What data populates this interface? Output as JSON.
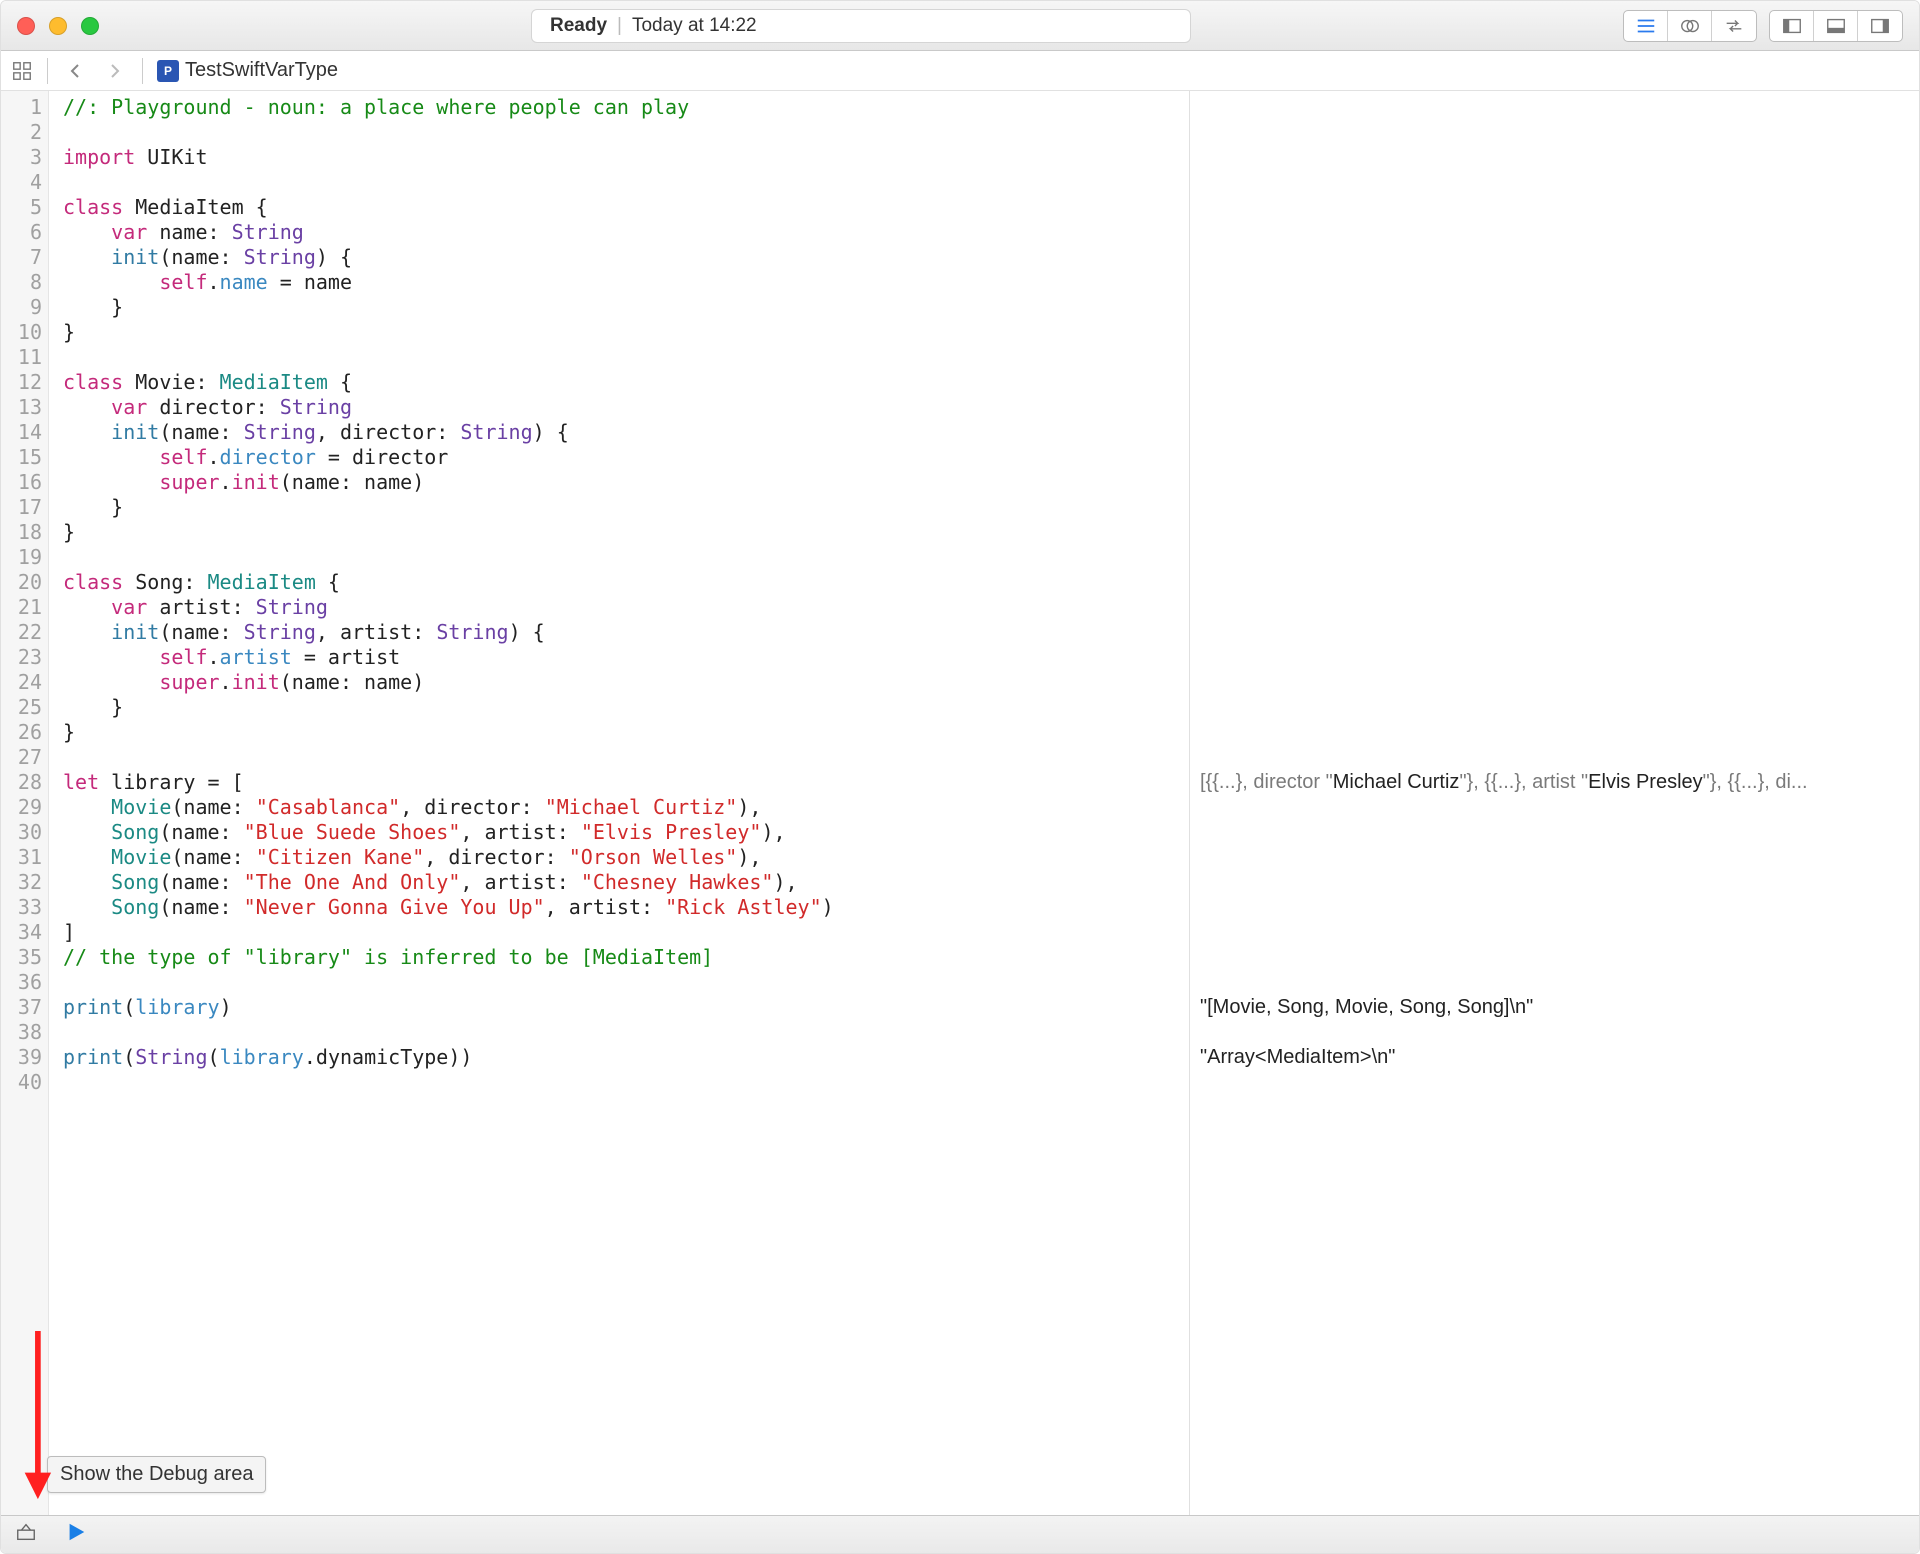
{
  "titlebar": {
    "status_label": "Ready",
    "status_time": "Today at 14:22"
  },
  "jumpbar": {
    "file_name": "TestSwiftVarType"
  },
  "tooltip": {
    "text": "Show the Debug area"
  },
  "code": {
    "lines": [
      [
        {
          "t": "//: Playground - noun: a place where people can play",
          "c": "c-comment"
        }
      ],
      [],
      [
        {
          "t": "import",
          "c": "c-key"
        },
        {
          "t": " UIKit"
        }
      ],
      [],
      [
        {
          "t": "class",
          "c": "c-key"
        },
        {
          "t": " MediaItem {"
        }
      ],
      [
        {
          "t": "    "
        },
        {
          "t": "var",
          "c": "c-key"
        },
        {
          "t": " name: "
        },
        {
          "t": "String",
          "c": "c-type"
        }
      ],
      [
        {
          "t": "    "
        },
        {
          "t": "init",
          "c": "c-param"
        },
        {
          "t": "(name: "
        },
        {
          "t": "String",
          "c": "c-type"
        },
        {
          "t": ") {"
        }
      ],
      [
        {
          "t": "        "
        },
        {
          "t": "self",
          "c": "c-self"
        },
        {
          "t": "."
        },
        {
          "t": "name",
          "c": "c-prop"
        },
        {
          "t": " = name"
        }
      ],
      [
        {
          "t": "    }"
        }
      ],
      [
        {
          "t": "}"
        }
      ],
      [],
      [
        {
          "t": "class",
          "c": "c-key"
        },
        {
          "t": " Movie: "
        },
        {
          "t": "MediaItem",
          "c": "c-usertype"
        },
        {
          "t": " {"
        }
      ],
      [
        {
          "t": "    "
        },
        {
          "t": "var",
          "c": "c-key"
        },
        {
          "t": " director: "
        },
        {
          "t": "String",
          "c": "c-type"
        }
      ],
      [
        {
          "t": "    "
        },
        {
          "t": "init",
          "c": "c-param"
        },
        {
          "t": "(name: "
        },
        {
          "t": "String",
          "c": "c-type"
        },
        {
          "t": ", director: "
        },
        {
          "t": "String",
          "c": "c-type"
        },
        {
          "t": ") {"
        }
      ],
      [
        {
          "t": "        "
        },
        {
          "t": "self",
          "c": "c-self"
        },
        {
          "t": "."
        },
        {
          "t": "director",
          "c": "c-prop"
        },
        {
          "t": " = director"
        }
      ],
      [
        {
          "t": "        "
        },
        {
          "t": "super",
          "c": "c-self"
        },
        {
          "t": "."
        },
        {
          "t": "init",
          "c": "c-key"
        },
        {
          "t": "(name: name)"
        }
      ],
      [
        {
          "t": "    }"
        }
      ],
      [
        {
          "t": "}"
        }
      ],
      [],
      [
        {
          "t": "class",
          "c": "c-key"
        },
        {
          "t": " Song: "
        },
        {
          "t": "MediaItem",
          "c": "c-usertype"
        },
        {
          "t": " {"
        }
      ],
      [
        {
          "t": "    "
        },
        {
          "t": "var",
          "c": "c-key"
        },
        {
          "t": " artist: "
        },
        {
          "t": "String",
          "c": "c-type"
        }
      ],
      [
        {
          "t": "    "
        },
        {
          "t": "init",
          "c": "c-param"
        },
        {
          "t": "(name: "
        },
        {
          "t": "String",
          "c": "c-type"
        },
        {
          "t": ", artist: "
        },
        {
          "t": "String",
          "c": "c-type"
        },
        {
          "t": ") {"
        }
      ],
      [
        {
          "t": "        "
        },
        {
          "t": "self",
          "c": "c-self"
        },
        {
          "t": "."
        },
        {
          "t": "artist",
          "c": "c-prop"
        },
        {
          "t": " = artist"
        }
      ],
      [
        {
          "t": "        "
        },
        {
          "t": "super",
          "c": "c-self"
        },
        {
          "t": "."
        },
        {
          "t": "init",
          "c": "c-key"
        },
        {
          "t": "(name: name)"
        }
      ],
      [
        {
          "t": "    }"
        }
      ],
      [
        {
          "t": "}"
        }
      ],
      [],
      [
        {
          "t": "let",
          "c": "c-key"
        },
        {
          "t": " library = ["
        }
      ],
      [
        {
          "t": "    "
        },
        {
          "t": "Movie",
          "c": "c-usertype"
        },
        {
          "t": "(name: "
        },
        {
          "t": "\"Casablanca\"",
          "c": "c-string"
        },
        {
          "t": ", director: "
        },
        {
          "t": "\"Michael Curtiz\"",
          "c": "c-string"
        },
        {
          "t": "),"
        }
      ],
      [
        {
          "t": "    "
        },
        {
          "t": "Song",
          "c": "c-usertype"
        },
        {
          "t": "(name: "
        },
        {
          "t": "\"Blue Suede Shoes\"",
          "c": "c-string"
        },
        {
          "t": ", artist: "
        },
        {
          "t": "\"Elvis Presley\"",
          "c": "c-string"
        },
        {
          "t": "),"
        }
      ],
      [
        {
          "t": "    "
        },
        {
          "t": "Movie",
          "c": "c-usertype"
        },
        {
          "t": "(name: "
        },
        {
          "t": "\"Citizen Kane\"",
          "c": "c-string"
        },
        {
          "t": ", director: "
        },
        {
          "t": "\"Orson Welles\"",
          "c": "c-string"
        },
        {
          "t": "),"
        }
      ],
      [
        {
          "t": "    "
        },
        {
          "t": "Song",
          "c": "c-usertype"
        },
        {
          "t": "(name: "
        },
        {
          "t": "\"The One And Only\"",
          "c": "c-string"
        },
        {
          "t": ", artist: "
        },
        {
          "t": "\"Chesney Hawkes\"",
          "c": "c-string"
        },
        {
          "t": "),"
        }
      ],
      [
        {
          "t": "    "
        },
        {
          "t": "Song",
          "c": "c-usertype"
        },
        {
          "t": "(name: "
        },
        {
          "t": "\"Never Gonna Give You Up\"",
          "c": "c-string"
        },
        {
          "t": ", artist: "
        },
        {
          "t": "\"Rick Astley\"",
          "c": "c-string"
        },
        {
          "t": ")"
        }
      ],
      [
        {
          "t": "]"
        }
      ],
      [
        {
          "t": "// the type of \"library\" is inferred to be [MediaItem]",
          "c": "c-comment"
        }
      ],
      [],
      [
        {
          "t": "print",
          "c": "c-param"
        },
        {
          "t": "("
        },
        {
          "t": "library",
          "c": "c-prop"
        },
        {
          "t": ")"
        }
      ],
      [],
      [
        {
          "t": "print",
          "c": "c-param"
        },
        {
          "t": "("
        },
        {
          "t": "String",
          "c": "c-type"
        },
        {
          "t": "("
        },
        {
          "t": "library",
          "c": "c-prop"
        },
        {
          "t": ".dynamicType))"
        }
      ],
      []
    ],
    "total_lines": 40
  },
  "results": {
    "28": [
      {
        "t": "[{{...}, director \""
      },
      {
        "t": "Michael Curtiz",
        "b": true
      },
      {
        "t": "\"}, {{...}, artist \""
      },
      {
        "t": "Elvis Presley",
        "b": true
      },
      {
        "t": "\"}, {{...}, di..."
      }
    ],
    "37": [
      {
        "t": "\"[Movie, Song, Movie, Song, Song]\\n\"",
        "b": true
      }
    ],
    "39": [
      {
        "t": "\"Array<MediaItem>\\n\"",
        "b": true
      }
    ]
  }
}
